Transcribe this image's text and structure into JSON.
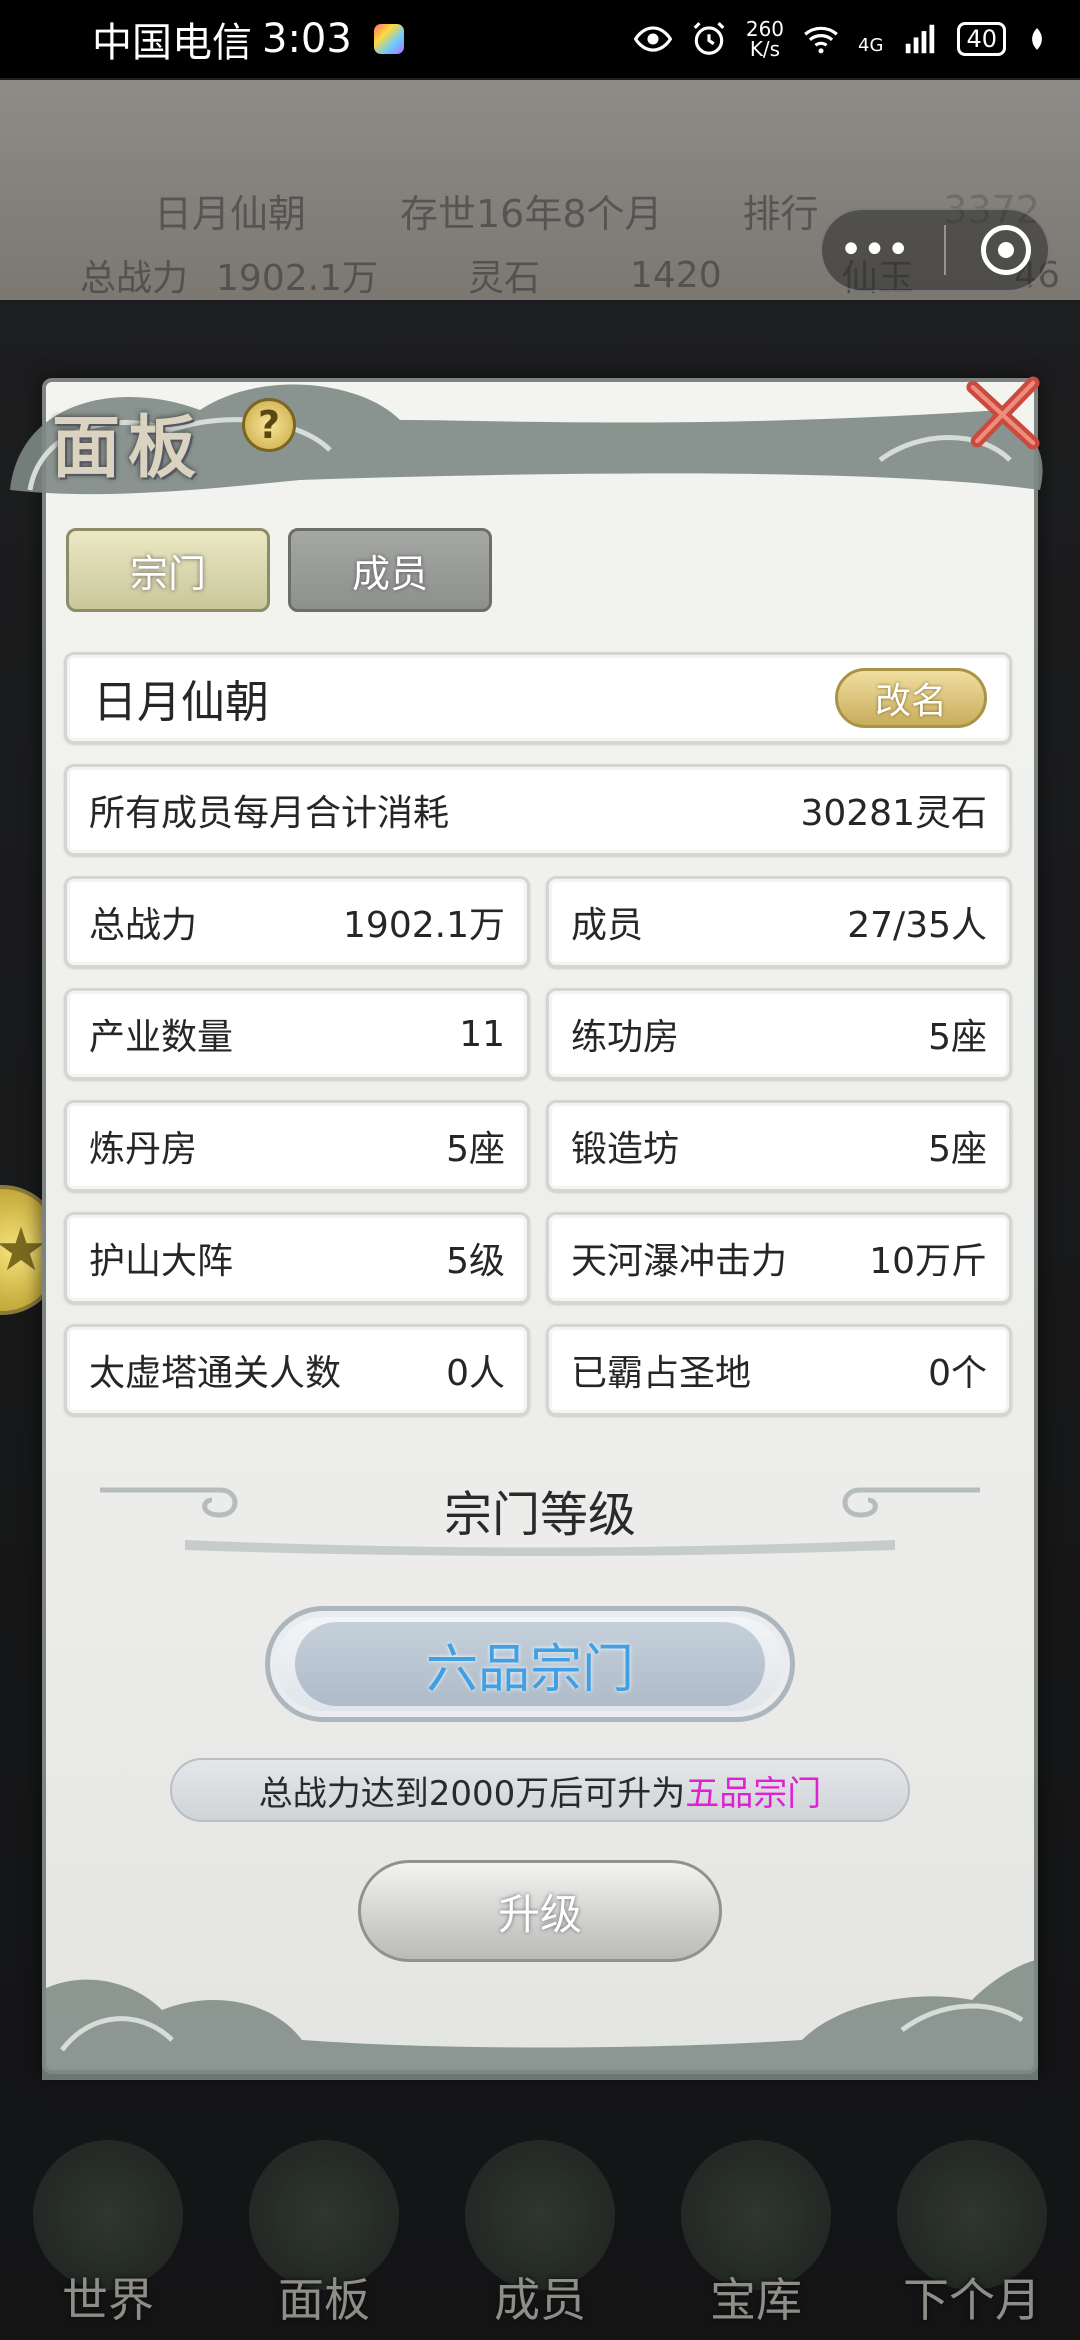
{
  "status_bar": {
    "carrier": "中国电信",
    "time": "3:03",
    "net_speed_value": "260",
    "net_speed_unit": "K/s",
    "network": "4G",
    "battery": "40"
  },
  "background": {
    "sect_name": "日月仙朝",
    "age": "存世16年8个月",
    "rank_label": "排行",
    "rank_value": "3372",
    "power_label": "总战力",
    "power_value": "1902.1万",
    "stone_label": "灵石",
    "stone_value": "1420",
    "jade_label": "仙玉",
    "jade_value": "46",
    "nav": [
      "世界",
      "面板",
      "成员",
      "宝库",
      "下个月"
    ]
  },
  "panel": {
    "title": "面板",
    "help": "?",
    "tabs": [
      "宗门",
      "成员"
    ],
    "sect_name": "日月仙朝",
    "rename_label": "改名",
    "consume_label": "所有成员每月合计消耗",
    "consume_value": "30281灵石",
    "stats": [
      {
        "label": "总战力",
        "value": "1902.1万"
      },
      {
        "label": "成员",
        "value": "27/35人"
      },
      {
        "label": "产业数量",
        "value": "11"
      },
      {
        "label": "练功房",
        "value": "5座"
      },
      {
        "label": "炼丹房",
        "value": "5座"
      },
      {
        "label": "锻造坊",
        "value": "5座"
      },
      {
        "label": "护山大阵",
        "value": "5级"
      },
      {
        "label": "天河瀑冲击力",
        "value": "10万斤"
      },
      {
        "label": "太虚塔通关人数",
        "value": "0人"
      },
      {
        "label": "已霸占圣地",
        "value": "0个"
      }
    ],
    "level_title": "宗门等级",
    "level_value": "六品宗门",
    "hint_prefix": "总战力达到2000万后可升为",
    "hint_highlight": "五品宗门",
    "upgrade_label": "升级"
  },
  "colors": {
    "highlight": "#e21fd2",
    "level_text": "#3fa0e6",
    "rename_gold": "#c8ad5c"
  }
}
